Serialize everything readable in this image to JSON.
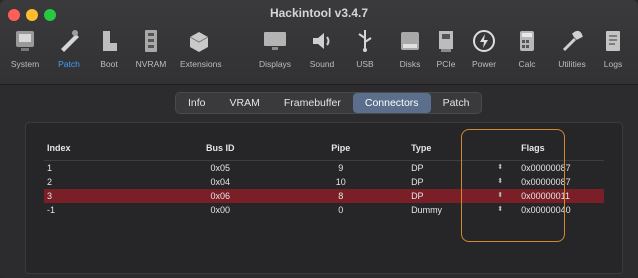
{
  "window": {
    "title": "Hackintool v3.4.7"
  },
  "colors": {
    "accent": "#3fa0ff",
    "selection": "#7a1e27",
    "highlight": "#d2892c"
  },
  "toolbar": {
    "items": [
      {
        "label": "System",
        "icon": "system-icon"
      },
      {
        "label": "Patch",
        "icon": "patch-icon",
        "active": true
      },
      {
        "label": "Boot",
        "icon": "boot-icon"
      },
      {
        "label": "NVRAM",
        "icon": "nvram-icon"
      },
      {
        "label": "Extensions",
        "icon": "extensions-icon"
      },
      {
        "label": "Displays",
        "icon": "displays-icon"
      },
      {
        "label": "Sound",
        "icon": "sound-icon"
      },
      {
        "label": "USB",
        "icon": "usb-icon"
      },
      {
        "label": "Disks",
        "icon": "disks-icon"
      },
      {
        "label": "PCIe",
        "icon": "pcie-icon"
      },
      {
        "label": "Power",
        "icon": "power-icon"
      },
      {
        "label": "Calc",
        "icon": "calc-icon"
      },
      {
        "label": "Utilities",
        "icon": "utilities-icon"
      },
      {
        "label": "Logs",
        "icon": "logs-icon"
      }
    ]
  },
  "tabs": [
    "Info",
    "VRAM",
    "Framebuffer",
    "Connectors",
    "Patch"
  ],
  "active_tab": "Connectors",
  "table": {
    "headers": {
      "index": "Index",
      "bus_id": "Bus ID",
      "pipe": "Pipe",
      "type": "Type",
      "flags": "Flags"
    },
    "rows": [
      {
        "index": "1",
        "bus_id": "0x05",
        "pipe": "9",
        "type": "DP",
        "flags": "0x00000087"
      },
      {
        "index": "2",
        "bus_id": "0x04",
        "pipe": "10",
        "type": "DP",
        "flags": "0x00000087"
      },
      {
        "index": "3",
        "bus_id": "0x06",
        "pipe": "8",
        "type": "DP",
        "flags": "0x00000011",
        "selected": true
      },
      {
        "index": "-1",
        "bus_id": "0x00",
        "pipe": "0",
        "type": "Dummy",
        "flags": "0x00000040"
      }
    ]
  }
}
